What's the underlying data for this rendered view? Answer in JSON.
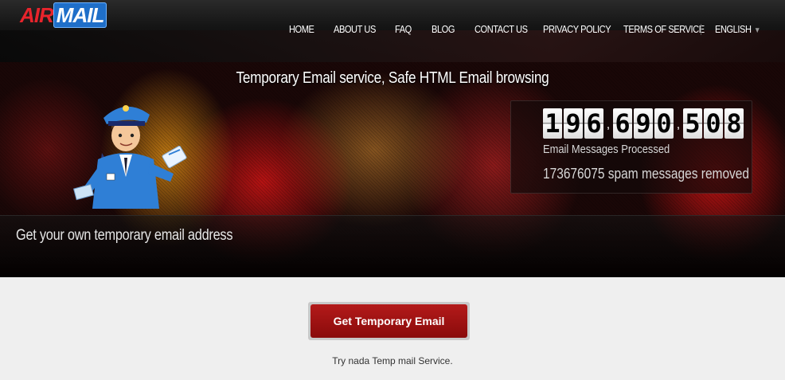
{
  "brand": {
    "logo_part1": "AIR",
    "logo_part2": "MAIL"
  },
  "nav": {
    "items": [
      {
        "label": "HOME"
      },
      {
        "label": "ABOUT US"
      },
      {
        "label": "FAQ"
      },
      {
        "label": "BLOG"
      },
      {
        "label": "CONTACT US"
      },
      {
        "label": "PRIVACY POLICY"
      },
      {
        "label": "TERMS OF SERVICE"
      }
    ],
    "language": "ENGLISH"
  },
  "hero": {
    "title": "Temporary Email service, Safe HTML Email browsing",
    "subtitle": "Get your own temporary email address",
    "counter": {
      "groups": [
        "196",
        "690",
        "508"
      ],
      "processed_label": "Email Messages Processed",
      "spam_text": "173676075 spam messages removed"
    }
  },
  "cta": {
    "button_label": "Get Temporary Email",
    "tagline": "Try nada Temp mail Service."
  },
  "colors": {
    "accent_red": "#a01515",
    "logo_red": "#e8242c",
    "logo_blue": "#1f6fc9"
  }
}
